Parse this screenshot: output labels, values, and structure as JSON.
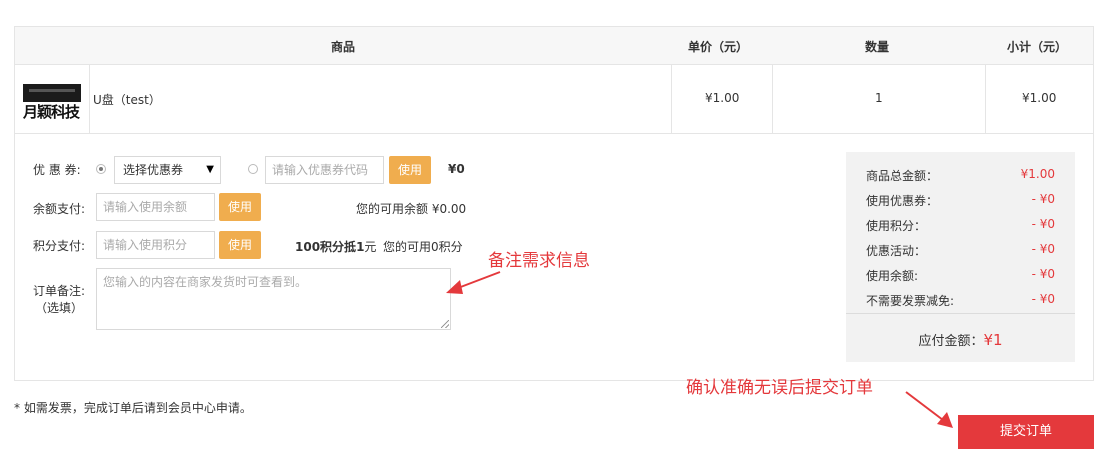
{
  "table": {
    "headers": {
      "product": "商品",
      "unit_price": "单价（元）",
      "quantity": "数量",
      "subtotal": "小计（元）"
    },
    "rows": [
      {
        "thumb_text": "月颖科技",
        "name": "U盘（test）",
        "unit_price": "¥1.00",
        "quantity": "1",
        "subtotal": "¥1.00"
      }
    ]
  },
  "coupon": {
    "label": "优 惠 券:",
    "select_value": "选择优惠券",
    "code_placeholder": "请输入优惠券代码",
    "use_label": "使用",
    "amount": "¥0"
  },
  "balance": {
    "label": "余额支付:",
    "placeholder": "请输入使用余额",
    "use_label": "使用",
    "available": "您的可用余额 ¥0.00"
  },
  "points": {
    "label": "积分支付:",
    "placeholder": "请输入使用积分",
    "use_label": "使用",
    "rule_prefix": "100积分抵",
    "rule_value": "1",
    "rule_unit": "元",
    "available": "您的可用0积分"
  },
  "remark": {
    "label_line1": "订单备注:",
    "label_line2": "（选填）",
    "placeholder": "您输入的内容在商家发货时可查看到。"
  },
  "summary": {
    "rows": [
      {
        "label": "商品总金额：",
        "value": "¥1.00"
      },
      {
        "label": "使用优惠券：",
        "value": "- ¥0"
      },
      {
        "label": "使用积分：",
        "value": "- ¥0"
      },
      {
        "label": "优惠活动：",
        "value": "- ¥0"
      },
      {
        "label": "使用余额:",
        "value": "- ¥0"
      },
      {
        "label": "不需要发票减免:",
        "value": "- ¥0"
      }
    ],
    "total_label": "应付金额：",
    "total_currency": "¥",
    "total_value": "1"
  },
  "invoice_note": "* 如需发票，完成订单后请到会员中心申请。",
  "annotations": {
    "remark_hint": "备注需求信息",
    "submit_hint": "确认准确无误后提交订单"
  },
  "submit_label": "提交订单",
  "colors": {
    "accent_red": "#e4393c",
    "use_button": "#f0ad4e"
  },
  "icons": {
    "annotation_arrow": "arrow-icon",
    "select_caret": "caret-down-icon"
  }
}
